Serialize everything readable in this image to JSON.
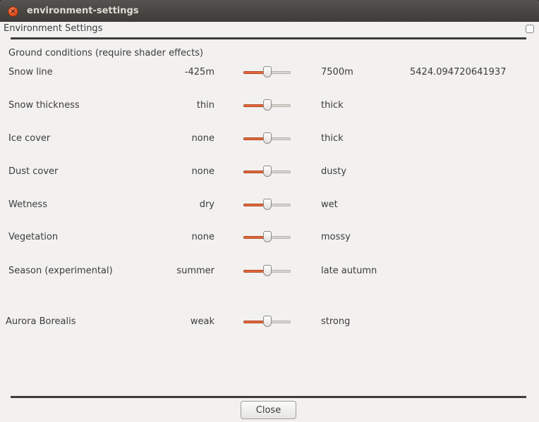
{
  "window": {
    "title": "environment-settings",
    "close_icon": "close-icon"
  },
  "dialog": {
    "title": "Environment Settings"
  },
  "ground": {
    "heading": "Ground conditions (require shader effects)"
  },
  "rows": [
    {
      "label": "Snow line",
      "min": "-425m",
      "max": "7500m",
      "value": "5424.094720641937",
      "level": 0.5
    },
    {
      "label": "Snow thickness",
      "min": "thin",
      "max": "thick",
      "level": 0.5
    },
    {
      "label": "Ice cover",
      "min": "none",
      "max": "thick",
      "level": 0.5
    },
    {
      "label": "Dust cover",
      "min": "none",
      "max": "dusty",
      "level": 0.5
    },
    {
      "label": "Wetness",
      "min": "dry",
      "max": "wet",
      "level": 0.5
    },
    {
      "label": "Vegetation",
      "min": "none",
      "max": "mossy",
      "level": 0.5
    },
    {
      "label": "Season (experimental)",
      "min": "summer",
      "max": "late autumn",
      "level": 0.5
    },
    {
      "label": "Aurora Borealis",
      "min": "weak",
      "max": "strong",
      "level": 0.5
    }
  ],
  "footer": {
    "close_label": "Close"
  },
  "colors": {
    "accent": "#e4683e",
    "titlebar": "#3d3c38",
    "background": "#f2f1f0"
  }
}
